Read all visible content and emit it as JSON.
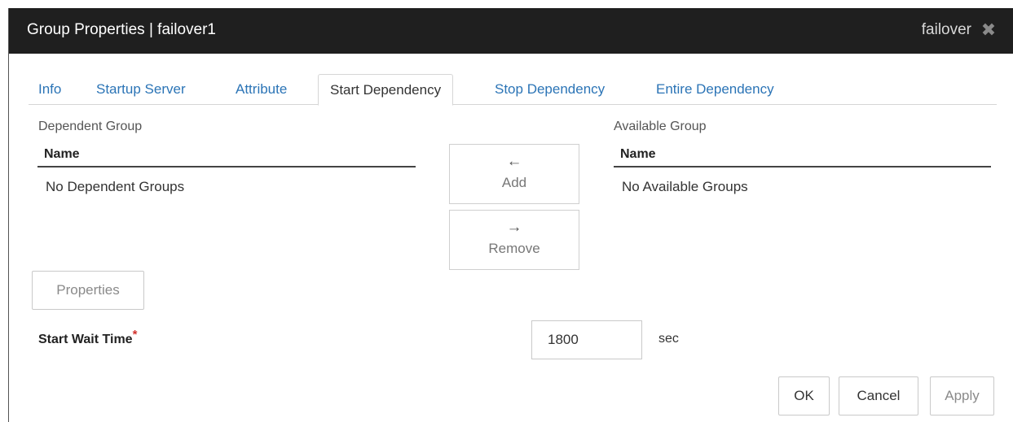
{
  "dialog": {
    "title": "Group Properties | failover1",
    "type_label": "failover",
    "close_glyph": "✖"
  },
  "tabs": [
    {
      "label": "Info"
    },
    {
      "label": "Startup Server"
    },
    {
      "label": "Attribute"
    },
    {
      "label": "Start Dependency",
      "active": true
    },
    {
      "label": "Stop Dependency"
    },
    {
      "label": "Entire Dependency"
    }
  ],
  "dependent": {
    "section_label": "Dependent Group",
    "column": "Name",
    "empty_text": "No Dependent Groups"
  },
  "available": {
    "section_label": "Available Group",
    "column": "Name",
    "empty_text": "No Available Groups"
  },
  "transfer": {
    "add_arrow": "←",
    "add_label": "Add",
    "remove_arrow": "→",
    "remove_label": "Remove"
  },
  "properties_label": "Properties",
  "start_wait": {
    "label": "Start Wait Time",
    "required_mark": "*",
    "value": "1800",
    "unit": "sec"
  },
  "footer": {
    "ok_label": "OK",
    "cancel_label": "Cancel",
    "apply_label": "Apply"
  },
  "colors": {
    "titlebar": "#1f1f1f",
    "tab_link": "#2b74b6",
    "required": "#d2322d"
  },
  "icons": {
    "close": "close-icon",
    "add_arrow": "arrow-left-icon",
    "remove_arrow": "arrow-right-icon"
  }
}
